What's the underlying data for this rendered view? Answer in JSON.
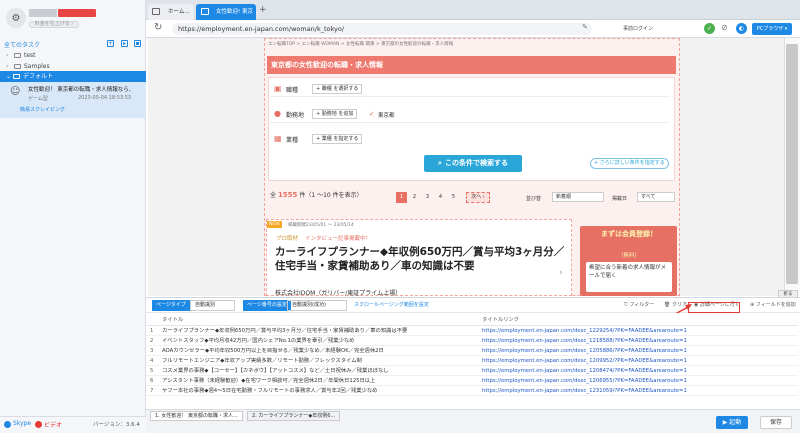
{
  "sidebar": {
    "upgrade_label": "料金を引上げる ›",
    "all_tasks": "全てのタスク",
    "folders": [
      "test",
      "Samples"
    ],
    "selected_folder": "デフォルト",
    "task": {
      "title": "女性歓迎！ 東京都の転職・求人情報なら、",
      "group": "ゲーム型",
      "date": "2023-05-04 18:53:53",
      "mode": "簡易スクレイピング"
    },
    "bottom": {
      "skype": "Skype",
      "video": "ビデオ",
      "version": "バージョン：3.6.4"
    }
  },
  "browser": {
    "tabs": [
      {
        "label": "ホーム..."
      },
      {
        "label": "女性歓迎! 東京 ×"
      }
    ],
    "url": "https://employment.en-japan.com/woman/k_tokyo/",
    "prelogin": "事前ログイン",
    "pc_browser": "PCブラウザ ▾"
  },
  "page": {
    "breadcrumb": "エン転職TOP > エン転職 WOMAN > 女性転職 関東 > 東京都の女性歓迎の転職・求人情報",
    "banner": "東京都の女性歓迎の転職・求人情報",
    "form": {
      "job_type_label": "職種",
      "job_type_btn": "+ 職種 を選択する",
      "location_label": "勤務地",
      "location_btn": "+ 勤務地 を追加",
      "location_checked": "東京都",
      "industry_label": "業種",
      "industry_btn": "+ 業種 を指定する",
      "search_btn": "この条件で検索する",
      "detail_btn": "+ さらに詳しい条件を指定する"
    },
    "results": {
      "prefix": "全",
      "count": "1555",
      "suffix": "件（1 ～10 件を表示）"
    },
    "pages": [
      "1",
      "2",
      "3",
      "4",
      "5"
    ],
    "next_label": "次へ ›",
    "sort_label": "並び替",
    "sort_value": "新着順",
    "date_label": "掲載日",
    "date_value": "すべて",
    "job": {
      "new": "NEW",
      "period": "掲載期間23/05/01 ～ 23/05/14",
      "pro_badge": "プロ取材",
      "interview": "インタビュー記事掲載中！",
      "headline": "カーライフプランナー◆年収例650万円／賞与平均3ヶ月分／住宅手当・家賃補助あり／車の知識は不要",
      "company": "株式会社IDOM（ガリバー/東証プライム上場）"
    },
    "ad": {
      "line1": "まずは会員登録！",
      "line2": "（無料）",
      "line3": "希望に合う新着の求人情報がメールで届く"
    }
  },
  "toolbar": {
    "type_label": "ページタイプ",
    "type_value": "自動識別",
    "pager_label": "ページ番号の設定",
    "pager_value": "自動識別(成功)",
    "scroll_label": "スクロールページング範囲を設定",
    "filter": "フィルター",
    "clear": "クリア",
    "detail": "詳細ページに行く",
    "add_field": "フィールドを追加",
    "collapse": "折る"
  },
  "grid": {
    "headers": [
      "タイトル",
      "タイトルリンク"
    ],
    "rows": [
      {
        "n": "1",
        "title": "カーライフプランナー◆年収例650万円／賞与平均3ヶ月分／住宅手当・家賃補助あり／車の知識は不要",
        "link": "https://employment.en-japan.com/desc_1229254/?PK=FAADEE&arearoute=1"
      },
      {
        "n": "2",
        "title": "イベントスタッフ◆平均月収42万円／国内シェアNo.1の業界を牽引／残業少なめ",
        "link": "https://employment.en-japan.com/desc_1218588/?PK=FAADEE&arearoute=1"
      },
      {
        "n": "3",
        "title": "AOAカウンセラー◆平均年収500万円以上を目指せる／残業少なめ／未経験OK／完全週休2日",
        "link": "https://employment.en-japan.com/desc_1205886/?PK=FAADEE&arearoute=1"
      },
      {
        "n": "4",
        "title": "フルリモートエンジニア◆年収アップ実績多数／リモート勤務／フレックスタイム制",
        "link": "https://employment.en-japan.com/desc_1209952/?PK=FAADEE&arearoute=1"
      },
      {
        "n": "5",
        "title": "コスメ業界の事務◆【コーセー】【カネボウ】【アットコスメ】など／土日祝休み／残業ほぼなし",
        "link": "https://employment.en-japan.com/desc_1208474/?PK=FAADEE&arearoute=1"
      },
      {
        "n": "6",
        "title": "アシスタント事務（未経験歓迎）◆在宅ワーク相談可／完全週休2日／年間休日125日以上",
        "link": "https://employment.en-japan.com/desc_1206955/?PK=FAADEE&arearoute=1"
      },
      {
        "n": "7",
        "title": "ヤフー本社の事務◆週4～5日在宅勤務・フルリモートの事務求人／賞与年2回／残業少なめ",
        "link": "https://employment.en-japan.com/desc_1231059/?PK=FAADEE&arearoute=1"
      }
    ]
  },
  "bottom": {
    "tab1": "1. 女性歓迎！ 東京都の転職・求人...",
    "tab2": "2. カーライフプランナー◆年収例6...",
    "start": "起動",
    "save": "保存"
  },
  "colors": {
    "accent": "#1e88e5",
    "banner": "#ee7a6f",
    "search": "#2aa7d8",
    "highlight": "#e53935"
  }
}
